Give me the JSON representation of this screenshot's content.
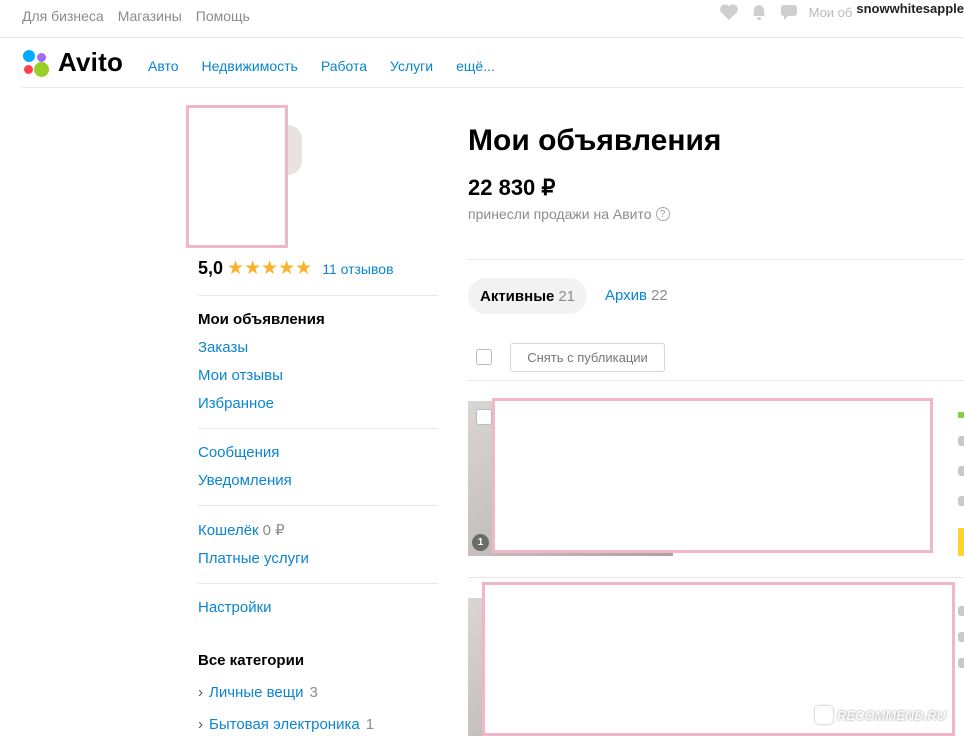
{
  "topbar": {
    "links": [
      "Для бизнеса",
      "Магазины",
      "Помощь"
    ],
    "username": "snowwhitesapple",
    "cut_text": "Мои об",
    "icons": [
      "heart-icon",
      "bell-icon",
      "chat-icon"
    ]
  },
  "nav": {
    "logo_text": "Avito",
    "logo_colors": [
      "#00aaff",
      "#a169f7",
      "#ff4053",
      "#97cf26"
    ],
    "items": [
      "Авто",
      "Недвижимость",
      "Работа",
      "Услуги",
      "ещё..."
    ]
  },
  "profile": {
    "rating": "5,0",
    "stars": 5,
    "stars_glyphs": "★★★★★",
    "reviews_link": "11 отзывов"
  },
  "sidebar": {
    "group1": [
      {
        "label": "Мои объявления",
        "active": true
      },
      {
        "label": "Заказы"
      },
      {
        "label": "Мои отзывы"
      },
      {
        "label": "Избранное"
      }
    ],
    "group2": [
      {
        "label": "Сообщения"
      },
      {
        "label": "Уведомления"
      }
    ],
    "group3": [
      {
        "label": "Кошелёк",
        "count": "0 ₽"
      },
      {
        "label": "Платные услуги"
      }
    ],
    "group4": [
      {
        "label": "Настройки"
      }
    ],
    "categories_title": "Все категории",
    "categories": [
      {
        "label": "Личные вещи",
        "count": "3"
      },
      {
        "label": "Бытовая электроника",
        "count": "1"
      }
    ]
  },
  "main": {
    "title": "Мои объявления",
    "revenue": "22 830 ₽",
    "revenue_note": "принесли продажи на Авито",
    "tabs": [
      {
        "label": "Активные",
        "count": "21",
        "active": true
      },
      {
        "label": "Архив",
        "count": "22"
      }
    ],
    "unpublish_button": "Снять с публикации",
    "listings": [
      {
        "photo_count": "1"
      },
      {}
    ]
  },
  "watermark": {
    "text": "RECOMMEND.RU"
  }
}
